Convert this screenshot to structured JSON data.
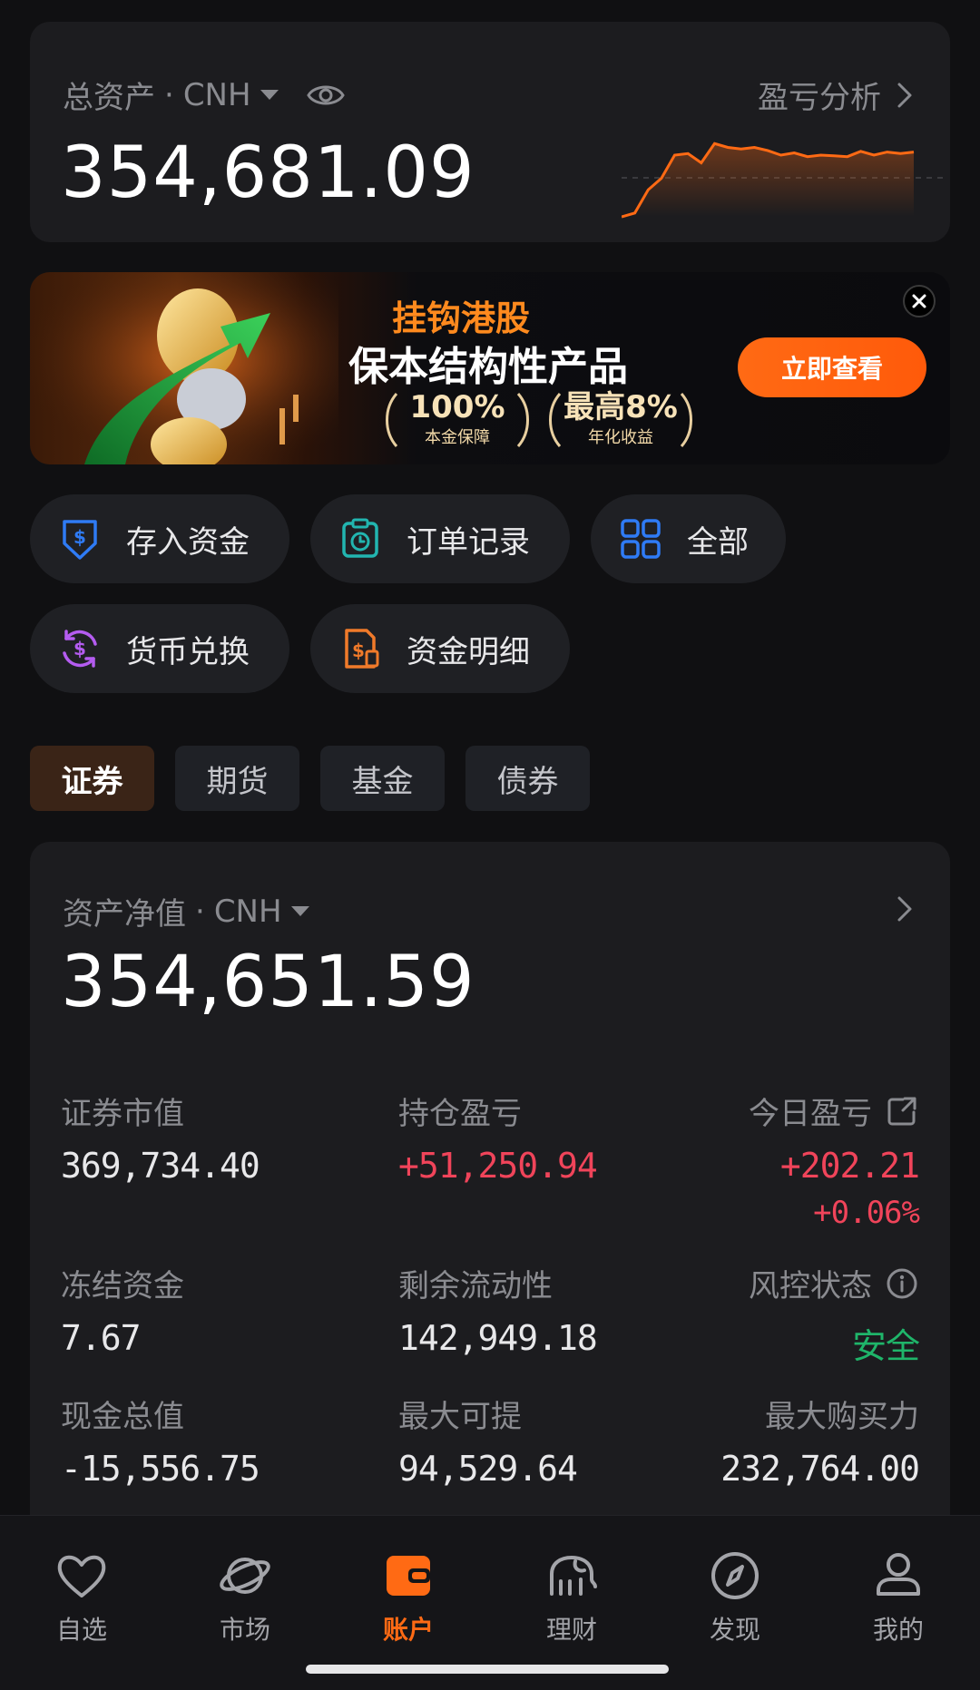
{
  "asset_card": {
    "label": "总资产",
    "currency": "CNH",
    "total": "354,681.09",
    "pl_link": "盈亏分析"
  },
  "banner": {
    "title1": "挂钩港股",
    "title2": "保本结构性产品",
    "badge1_main": "100%",
    "badge1_sub": "本金保障",
    "badge2_main": "最高8%",
    "badge2_sub": "年化收益",
    "cta": "立即查看"
  },
  "actions": [
    {
      "label": "存入资金",
      "icon": "deposit-icon",
      "color": "#2F7BF5"
    },
    {
      "label": "订单记录",
      "icon": "order-record-icon",
      "color": "#22B5B0"
    },
    {
      "label": "全部",
      "icon": "grid-icon",
      "color": "#2F7BF5"
    },
    {
      "label": "货币兑换",
      "icon": "currency-exchange-icon",
      "color": "#B45CF0"
    },
    {
      "label": "资金明细",
      "icon": "fund-detail-icon",
      "color": "#F07A2A"
    }
  ],
  "tabs": [
    "证券",
    "期货",
    "基金",
    "债券"
  ],
  "net_card": {
    "label": "资产净值",
    "currency": "CNH",
    "total": "354,651.59",
    "metrics": {
      "market_value_label": "证券市值",
      "market_value": "369,734.40",
      "position_pl_label": "持仓盈亏",
      "position_pl": "+51,250.94",
      "today_pl_label": "今日盈亏",
      "today_pl": "+202.21",
      "today_pl_pct": "+0.06%",
      "frozen_label": "冻结资金",
      "frozen": "7.67",
      "liquidity_label": "剩余流动性",
      "liquidity": "142,949.18",
      "risk_label": "风控状态",
      "risk": "安全",
      "cash_label": "现金总值",
      "cash": "-15,556.75",
      "max_withdraw_label": "最大可提",
      "max_withdraw": "94,529.64",
      "max_buy_label": "最大购买力",
      "max_buy": "232,764.00"
    }
  },
  "nav": [
    {
      "label": "自选",
      "icon": "heart-icon"
    },
    {
      "label": "市场",
      "icon": "planet-icon"
    },
    {
      "label": "账户",
      "icon": "wallet-icon"
    },
    {
      "label": "理财",
      "icon": "elephant-icon"
    },
    {
      "label": "发现",
      "icon": "compass-icon"
    },
    {
      "label": "我的",
      "icon": "person-icon"
    }
  ],
  "colors": {
    "accent": "#FF6A14",
    "gain": "#F0445A",
    "safe": "#1FB56A",
    "card": "#1C1C1F",
    "background": "#101012"
  },
  "mini_chart": {
    "values": [
      0,
      0.05,
      0.35,
      0.5,
      0.8,
      0.82,
      0.7,
      0.95,
      0.9,
      0.88,
      0.9,
      0.86,
      0.8,
      0.83,
      0.78,
      0.8,
      0.79,
      0.78,
      0.85,
      0.8,
      0.84,
      0.82,
      0.84
    ]
  }
}
